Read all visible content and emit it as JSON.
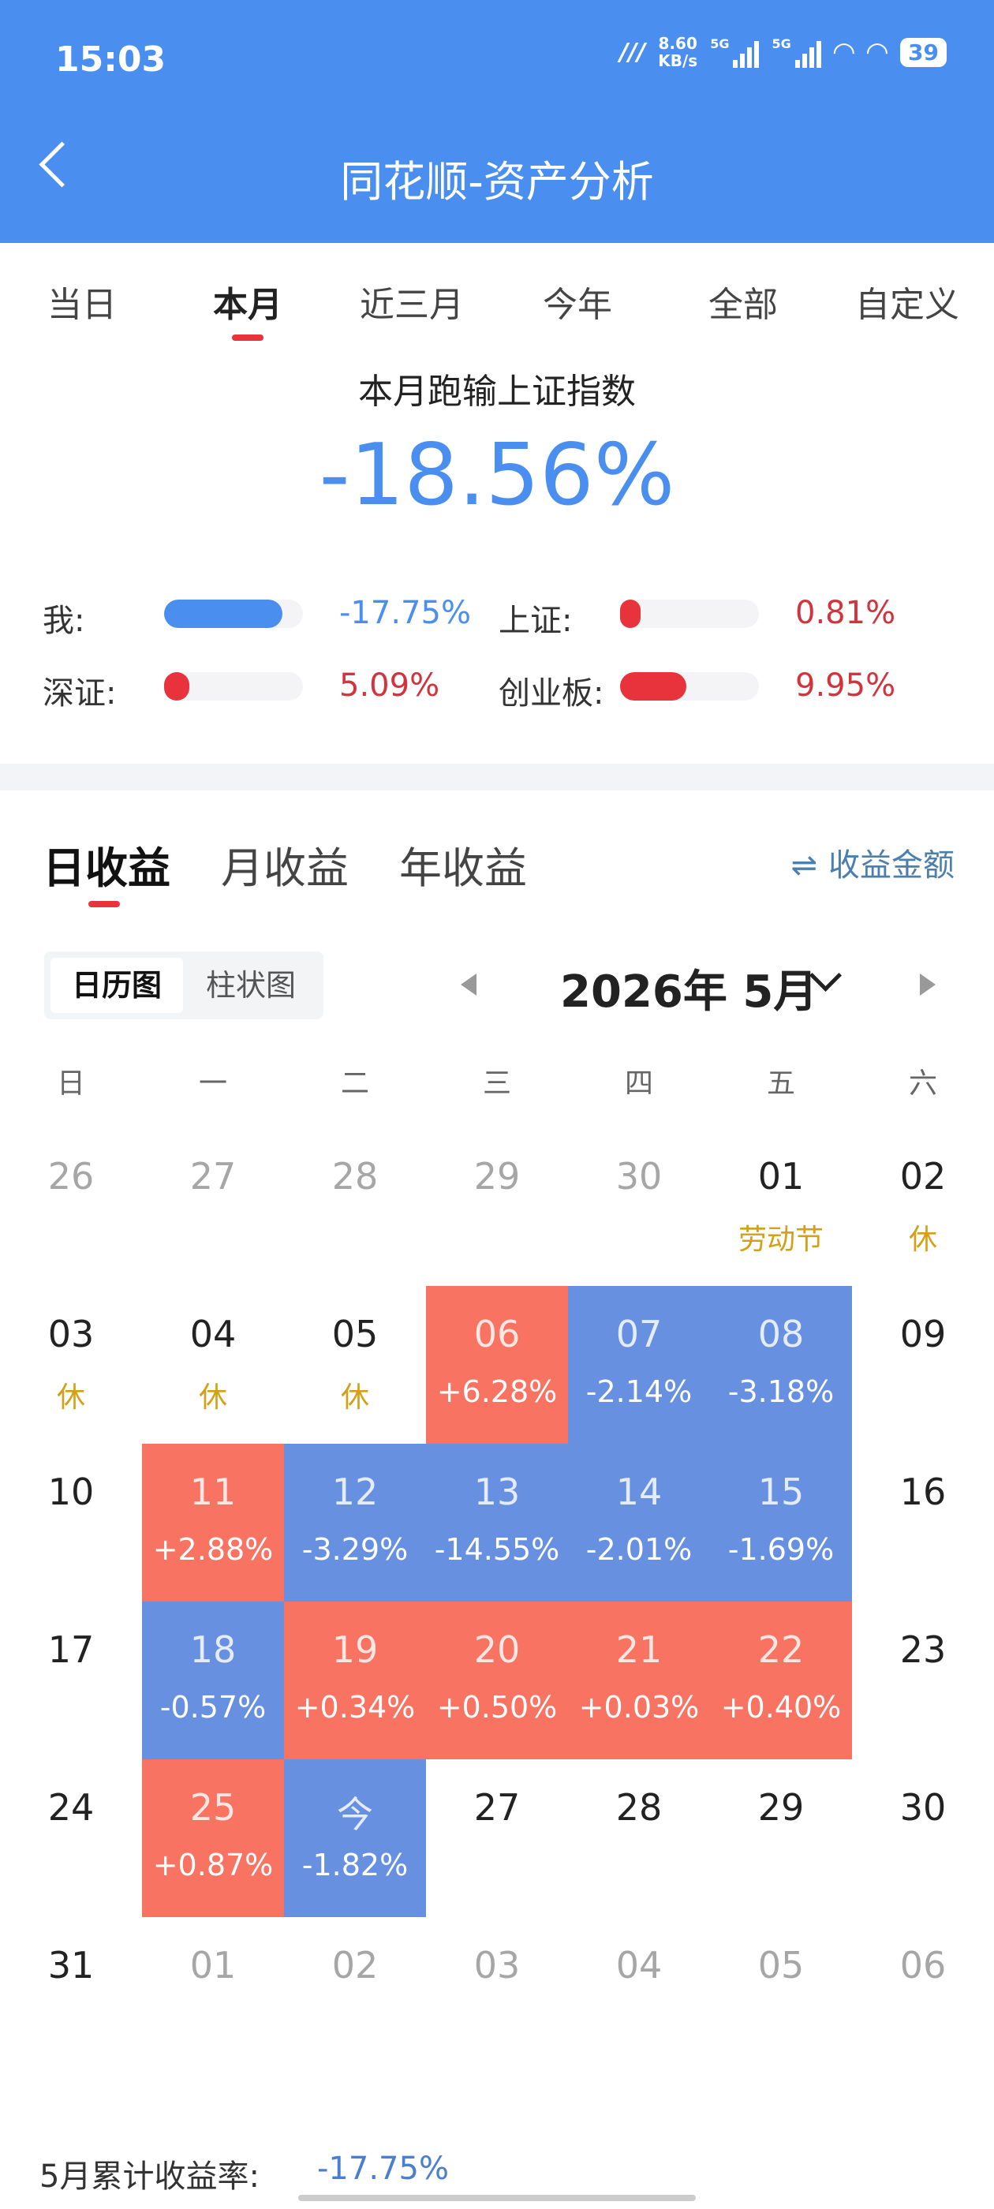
{
  "status": {
    "time": "15:03",
    "speed_value": "8.60",
    "speed_unit": "KB/s",
    "network1": "5G",
    "network2": "5G",
    "battery": "39"
  },
  "header": {
    "title": "同花顺-资产分析"
  },
  "period_tabs": [
    "当日",
    "本月",
    "近三月",
    "今年",
    "全部",
    "自定义"
  ],
  "active_period": "本月",
  "summary": {
    "title": "本月跑输上证指数",
    "value": "-18.56%"
  },
  "comparisons": [
    {
      "label": "我:",
      "value": "-17.75%",
      "direction": "down",
      "level": 0.85
    },
    {
      "label": "上证:",
      "value": "0.81%",
      "direction": "up",
      "level": 0.08
    },
    {
      "label": "深证:",
      "value": "5.09%",
      "direction": "up",
      "level": 0.18
    },
    {
      "label": "创业板:",
      "value": "9.95%",
      "direction": "up",
      "level": 0.48
    }
  ],
  "colors": {
    "up": "#f97362",
    "down": "#6890e0",
    "accent": "#4a8ff0",
    "red": "#e8323c",
    "holiday": "#d4a017"
  },
  "income_tabs": [
    "日收益",
    "月收益",
    "年收益"
  ],
  "amount_toggle": {
    "icon": "swap-arrows-icon",
    "label": "收益金额"
  },
  "view_toggle": {
    "calendar": "日历图",
    "bar": "柱状图"
  },
  "month_label": "2026年 5月",
  "weekdays": [
    "日",
    "一",
    "二",
    "三",
    "四",
    "五",
    "六"
  ],
  "weeks": [
    [
      {
        "d": "26",
        "o": true
      },
      {
        "d": "27",
        "o": true
      },
      {
        "d": "28",
        "o": true
      },
      {
        "d": "29",
        "o": true
      },
      {
        "d": "30",
        "o": true
      },
      {
        "d": "01",
        "note": "劳动节"
      },
      {
        "d": "02",
        "note": "休"
      }
    ],
    [
      {
        "d": "03",
        "note": "休"
      },
      {
        "d": "04",
        "note": "休"
      },
      {
        "d": "05",
        "note": "休"
      },
      {
        "d": "06",
        "pct": "+6.28%",
        "t": "up"
      },
      {
        "d": "07",
        "pct": "-2.14%",
        "t": "down"
      },
      {
        "d": "08",
        "pct": "-3.18%",
        "t": "down"
      },
      {
        "d": "09"
      }
    ],
    [
      {
        "d": "10"
      },
      {
        "d": "11",
        "pct": "+2.88%",
        "t": "up"
      },
      {
        "d": "12",
        "pct": "-3.29%",
        "t": "down"
      },
      {
        "d": "13",
        "pct": "-14.55%",
        "t": "down"
      },
      {
        "d": "14",
        "pct": "-2.01%",
        "t": "down"
      },
      {
        "d": "15",
        "pct": "-1.69%",
        "t": "down"
      },
      {
        "d": "16"
      }
    ],
    [
      {
        "d": "17"
      },
      {
        "d": "18",
        "pct": "-0.57%",
        "t": "down"
      },
      {
        "d": "19",
        "pct": "+0.34%",
        "t": "up"
      },
      {
        "d": "20",
        "pct": "+0.50%",
        "t": "up"
      },
      {
        "d": "21",
        "pct": "+0.03%",
        "t": "up"
      },
      {
        "d": "22",
        "pct": "+0.40%",
        "t": "up"
      },
      {
        "d": "23"
      }
    ],
    [
      {
        "d": "24"
      },
      {
        "d": "25",
        "pct": "+0.87%",
        "t": "up"
      },
      {
        "d": "今",
        "pct": "-1.82%",
        "t": "down"
      },
      {
        "d": "27"
      },
      {
        "d": "28"
      },
      {
        "d": "29"
      },
      {
        "d": "30"
      }
    ],
    [
      {
        "d": "31"
      },
      {
        "d": "01",
        "o": true
      },
      {
        "d": "02",
        "o": true
      },
      {
        "d": "03",
        "o": true
      },
      {
        "d": "04",
        "o": true
      },
      {
        "d": "05",
        "o": true
      },
      {
        "d": "06",
        "o": true
      }
    ]
  ],
  "footer": {
    "label": "5月累计收益率:",
    "value": "-17.75%"
  }
}
